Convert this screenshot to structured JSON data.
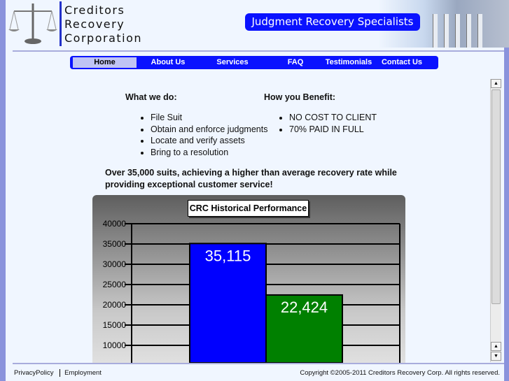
{
  "header": {
    "company_lines": [
      "Creditors",
      "Recovery",
      "Corporation"
    ],
    "tagline": "Judgment Recovery Specialists"
  },
  "nav": {
    "items": [
      {
        "label": "Home",
        "active": true
      },
      {
        "label": "About Us"
      },
      {
        "label": "Services"
      },
      {
        "label": "FAQ"
      },
      {
        "label": "Testimonials"
      },
      {
        "label": "Contact Us"
      }
    ]
  },
  "main": {
    "what_heading": "What we do:",
    "what_items": [
      "File Suit",
      "Obtain and enforce judgments",
      "Locate and verify assets",
      "Bring to a resolution"
    ],
    "benefit_heading": "How you Benefit:",
    "benefit_items": [
      "NO COST TO CLIENT",
      "70% PAID IN FULL"
    ],
    "statement": "Over 35,000 suits, achieving a higher than average recovery rate while providing exceptional customer service!"
  },
  "chart_data": {
    "type": "bar",
    "title": "CRC Historical Performance",
    "values": [
      35115,
      22424
    ],
    "value_labels": [
      "35,115",
      "22,424"
    ],
    "colors": [
      "#0000ff",
      "#008000"
    ],
    "yticks": [
      "40000",
      "35000",
      "30000",
      "25000",
      "20000",
      "15000",
      "10000"
    ],
    "ylim": [
      0,
      40000
    ],
    "grid": true
  },
  "footer": {
    "privacy": "PrivacyPolicy",
    "employment": "Employment",
    "copyright": "Copyright ©2005-2011 Creditors Recovery Corp. All rights reserved."
  }
}
